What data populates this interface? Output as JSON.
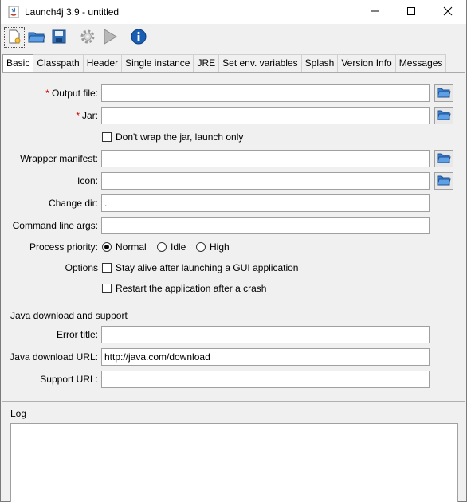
{
  "window": {
    "title": "Launch4j 3.9 - untitled"
  },
  "toolbar": {
    "buttons": [
      {
        "icon": "new-config-icon"
      },
      {
        "icon": "open-folder-icon"
      },
      {
        "icon": "save-icon"
      },
      {
        "icon": "gear-icon"
      },
      {
        "icon": "run-icon"
      },
      {
        "icon": "info-icon"
      }
    ]
  },
  "tabs": [
    "Basic",
    "Classpath",
    "Header",
    "Single instance",
    "JRE",
    "Set env. variables",
    "Splash",
    "Version Info",
    "Messages"
  ],
  "active_tab": "Basic",
  "basic": {
    "output_file_label": "Output file:",
    "output_file_value": "",
    "jar_label": "Jar:",
    "jar_value": "",
    "dont_wrap_label": "Don't wrap the jar, launch only",
    "wrapper_manifest_label": "Wrapper manifest:",
    "wrapper_manifest_value": "",
    "icon_label": "Icon:",
    "icon_value": "",
    "change_dir_label": "Change dir:",
    "change_dir_value": ".",
    "cmd_args_label": "Command line args:",
    "cmd_args_value": "",
    "priority_label": "Process priority:",
    "priority_options": [
      "Normal",
      "Idle",
      "High"
    ],
    "priority_selected": "Normal",
    "options_label": "Options",
    "stay_alive_label": "Stay alive after launching a GUI application",
    "restart_label": "Restart the application after a crash"
  },
  "java_group": {
    "title": "Java download and support",
    "error_title_label": "Error title:",
    "error_title_value": "",
    "download_url_label": "Java download URL:",
    "download_url_value": "http://java.com/download",
    "support_url_label": "Support URL:",
    "support_url_value": ""
  },
  "log": {
    "title": "Log",
    "content": ""
  },
  "colors": {
    "required_star": "#cc0000",
    "info_blue": "#1a5fb4",
    "folder_blue": "#3a7fd0"
  }
}
